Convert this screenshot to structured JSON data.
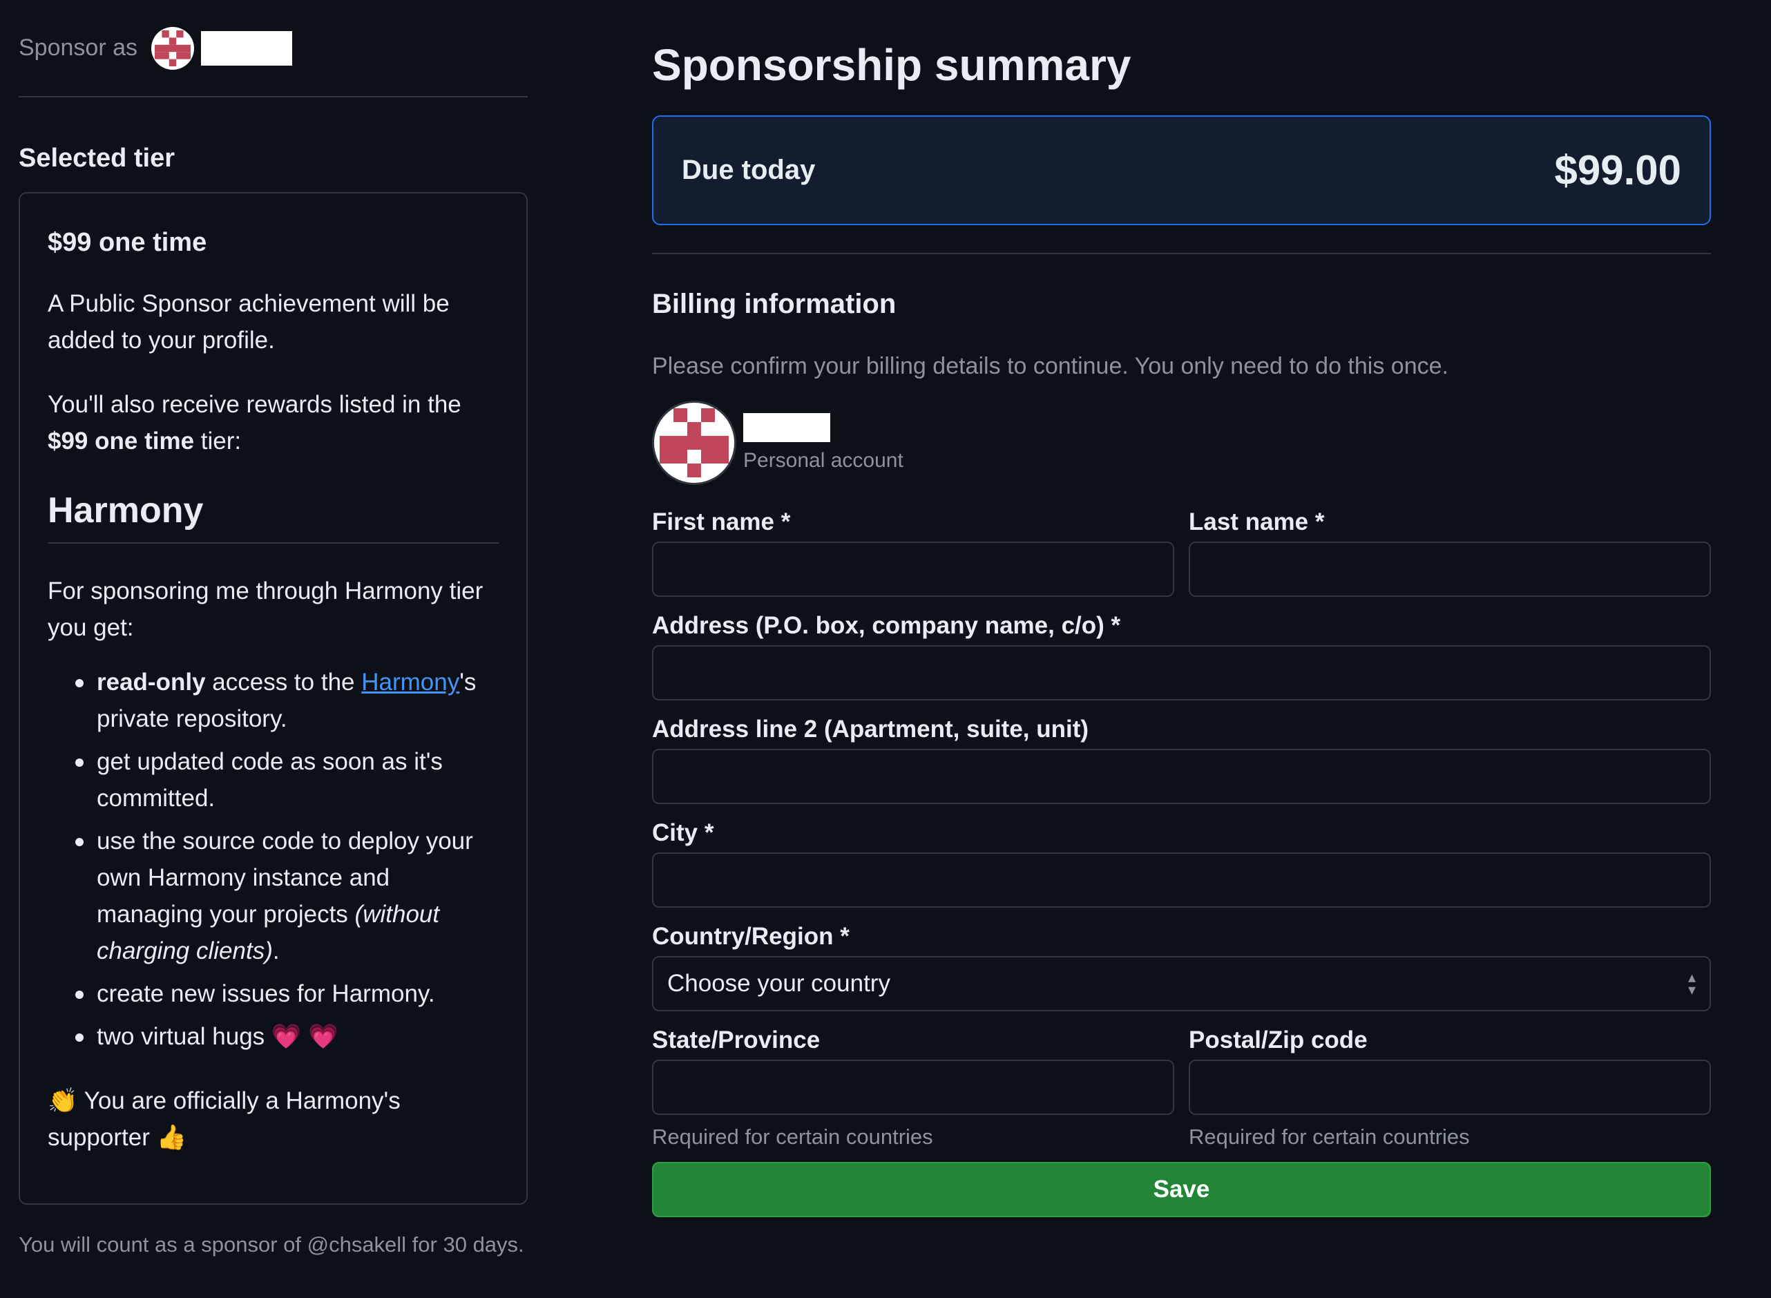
{
  "sponsor_as": {
    "label": "Sponsor as"
  },
  "selected_tier": {
    "heading": "Selected tier",
    "title": "$99 one time",
    "achievement": "A Public Sponsor achievement will be added to your profile.",
    "rewards_prefix": "You'll also receive rewards listed in the ",
    "rewards_tier": "$99 one time",
    "rewards_suffix": " tier:",
    "harmony_heading": "Harmony",
    "intro": "For sponsoring me through Harmony tier you get:",
    "benefits": {
      "b1_bold": "read-only",
      "b1_text": " access to the ",
      "b1_link": "Harmony",
      "b1_tail": "'s private repository.",
      "b2": "get updated code as soon as it's committed.",
      "b3_text": "use the source code to deploy your own Harmony instance and managing your projects ",
      "b3_italic": "(without charging clients)",
      "b3_tail": ".",
      "b4": "create new issues for Harmony.",
      "b5_text": "two virtual hugs ",
      "b5_hearts": "💗 💗"
    },
    "closing_emoji": "👏",
    "closing_text": " You are officially a Harmony's supporter ",
    "closing_emoji2": "👍"
  },
  "count_note": "You will count as a sponsor of @chsakell for 30 days.",
  "summary": {
    "title": "Sponsorship summary",
    "due_label": "Due today",
    "due_amount": "$99.00"
  },
  "billing": {
    "heading": "Billing information",
    "description": "Please confirm your billing details to continue. You only need to do this once.",
    "account_type": "Personal account",
    "fields": {
      "first_name": "First name *",
      "last_name": "Last name *",
      "address": "Address (P.O. box, company name, c/o) *",
      "address2": "Address line 2 (Apartment, suite, unit)",
      "city": "City *",
      "country": "Country/Region *",
      "country_value": "Choose your country",
      "state": "State/Province",
      "postal": "Postal/Zip code",
      "state_hint": "Required for certain countries",
      "postal_hint": "Required for certain countries"
    },
    "save_label": "Save"
  },
  "colors": {
    "background": "#0d1117",
    "accent_blue": "#1f6feb",
    "link": "#4493f8",
    "save_green": "#238636",
    "avatar_red": "#c0475a"
  },
  "icons": [
    "identicon-avatar",
    "select-arrows-icon"
  ]
}
